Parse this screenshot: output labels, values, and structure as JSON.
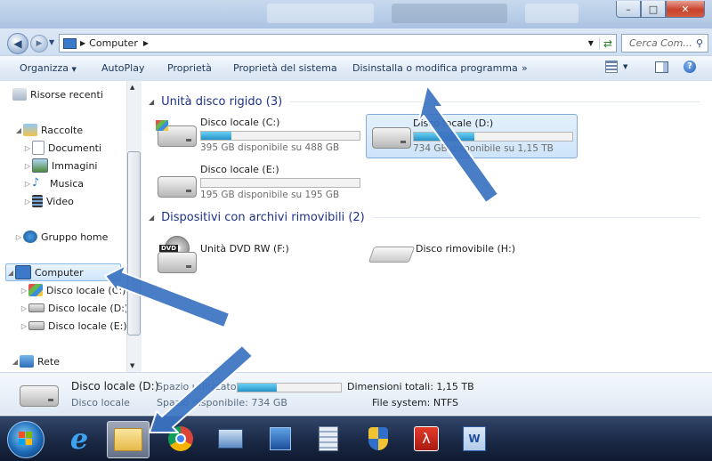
{
  "window": {
    "controls": [
      "minimize",
      "maximize",
      "close"
    ]
  },
  "address": {
    "path": [
      "Computer"
    ],
    "search_placeholder": "Cerca Com..."
  },
  "toolbar": {
    "organize": "Organizza",
    "autoplay": "AutoPlay",
    "properties": "Proprietà",
    "system_properties": "Proprietà del sistema",
    "uninstall": "Disinstalla o modifica programma",
    "more": "»"
  },
  "sidebar": {
    "recent": "Risorse recenti",
    "libraries": "Raccolte",
    "documents": "Documenti",
    "images": "Immagini",
    "music": "Musica",
    "video": "Video",
    "homegroup": "Gruppo home",
    "computer": "Computer",
    "drive_c": "Disco locale (C:)",
    "drive_d": "Disco locale (D:)",
    "drive_e": "Disco locale (E:)",
    "network": "Rete"
  },
  "content": {
    "hdd_group": "Unità disco rigido (3)",
    "removable_group": "Dispositivi con archivi rimovibili (2)",
    "drives": [
      {
        "name": "Disco locale (C:)",
        "free": "395 GB disponibile su 488 GB",
        "used_fraction": 0.19
      },
      {
        "name": "Disco locale (D:)",
        "free": "734 GB disponibile su 1,15 TB",
        "used_fraction": 0.38
      },
      {
        "name": "Disco locale (E:)",
        "free": "195 GB disponibile su 195 GB",
        "used_fraction": 0.0
      }
    ],
    "dvd": "Unità DVD RW (F:)",
    "removable": "Disco rimovibile (H:)",
    "dvd_badge": "DVD"
  },
  "details": {
    "name": "Disco locale (D:)",
    "type": "Disco locale",
    "space_used_label": "Spazio utilizzato:",
    "free_label": "Spazio disponibile: 734 GB",
    "total": "Dimensioni totali: 1,15 TB",
    "fs": "File system: NTFS",
    "used_fraction": 0.38
  },
  "taskbar": {
    "apps": [
      "start-orb",
      "internet-explorer",
      "windows-explorer",
      "chrome",
      "remote-desktop",
      "calculator",
      "security-shield",
      "acrobat-reader",
      "word"
    ]
  },
  "colors": {
    "arrow": "#3a73c2",
    "accent": "#1e3287",
    "bar_fill": "#2592c9"
  }
}
